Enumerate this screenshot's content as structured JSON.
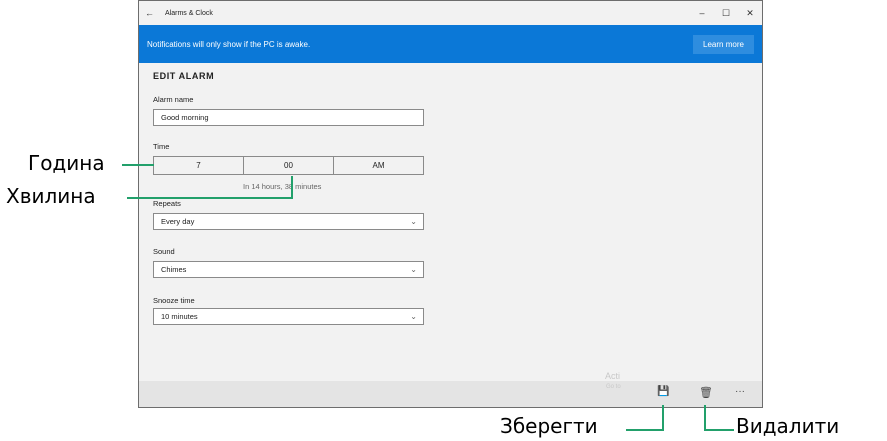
{
  "window": {
    "title": "Alarms & Clock",
    "back_icon": "←",
    "minimize_icon": "–",
    "maximize_icon": "☐",
    "close_icon": "✕"
  },
  "banner": {
    "message": "Notifications will only show if the PC is awake.",
    "learn_more": "Learn more",
    "color": "#0b78d7"
  },
  "form": {
    "heading": "EDIT ALARM",
    "alarm_name_label": "Alarm name",
    "alarm_name_value": "Good morning",
    "time_label": "Time",
    "time_hour": "7",
    "time_minute": "00",
    "time_period": "AM",
    "time_hint": "In 14 hours, 38 minutes",
    "repeats_label": "Repeats",
    "repeats_value": "Every day",
    "sound_label": "Sound",
    "sound_value": "Chimes",
    "snooze_label": "Snooze time",
    "snooze_value": "10 minutes"
  },
  "commandbar": {
    "save_icon": "💾",
    "delete_icon": "🗑",
    "more_icon": "···"
  },
  "watermark": {
    "line1": "Acti",
    "line2": "Go to"
  },
  "callouts": {
    "hour": "Година",
    "minute": "Хвилина",
    "save": "Зберегти",
    "delete": "Видалити",
    "line_color": "#22a06b"
  }
}
